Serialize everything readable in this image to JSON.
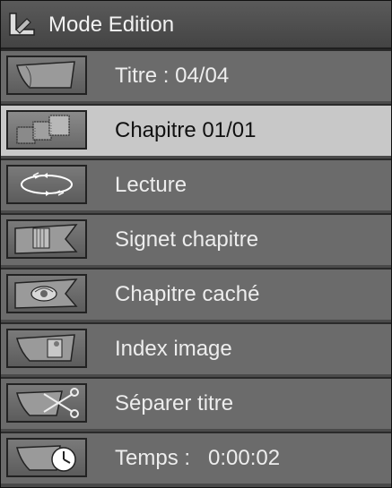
{
  "header": {
    "title": "Mode Edition",
    "icon": "mode-edit-l-icon"
  },
  "items": [
    {
      "label": "Titre : 04/04",
      "icon": "folder-icon",
      "selected": false
    },
    {
      "label": "Chapitre 01/01",
      "icon": "chapters-grid-icon",
      "selected": true
    },
    {
      "label": "Lecture",
      "icon": "playback-loop-icon",
      "selected": false
    },
    {
      "label": "Signet chapitre",
      "icon": "chapter-bookmark-icon",
      "selected": false
    },
    {
      "label": "Chapitre caché",
      "icon": "hidden-chapter-icon",
      "selected": false
    },
    {
      "label": "Index image",
      "icon": "index-image-icon",
      "selected": false
    },
    {
      "label": "Séparer titre",
      "icon": "split-title-scissors-icon",
      "selected": false
    },
    {
      "label": "Temps :   0:00:02",
      "icon": "time-clock-icon",
      "selected": false
    }
  ],
  "colors": {
    "row": "#6b6b6b",
    "selected_row": "#c8c8c8",
    "text": "#ededed",
    "selected_text": "#111111"
  }
}
